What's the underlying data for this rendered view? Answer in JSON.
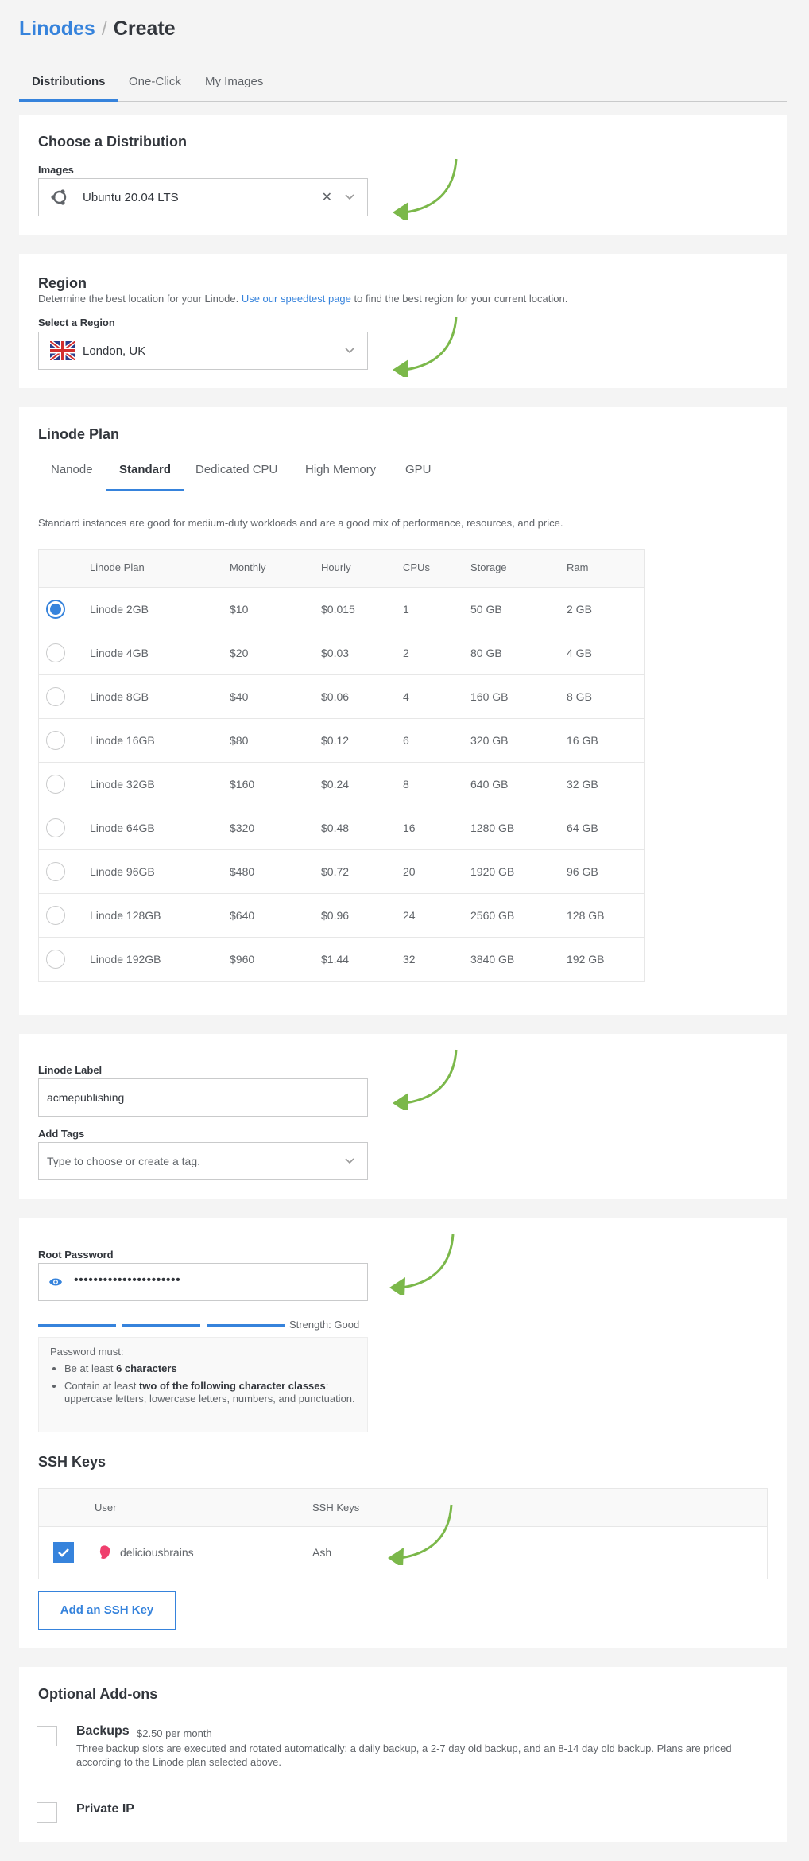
{
  "breadcrumb": {
    "parent": "Linodes",
    "separator": "/",
    "current": "Create"
  },
  "top_tabs": [
    "Distributions",
    "One-Click",
    "My Images"
  ],
  "distribution": {
    "title": "Choose a Distribution",
    "images_label": "Images",
    "selected_image": "Ubuntu 20.04 LTS",
    "clear_glyph": "✕"
  },
  "region": {
    "title": "Region",
    "desc_prefix": "Determine the best location for your Linode.",
    "desc_link": "Use our speedtest page",
    "desc_suffix": "to find the best region for your current location.",
    "select_label": "Select a Region",
    "selected_region": "London, UK"
  },
  "plan": {
    "title": "Linode Plan",
    "tabs": [
      "Nanode",
      "Standard",
      "Dedicated CPU",
      "High Memory",
      "GPU"
    ],
    "description": "Standard instances are good for medium-duty workloads and are a good mix of performance, resources, and price.",
    "headers": [
      "Linode Plan",
      "Monthly",
      "Hourly",
      "CPUs",
      "Storage",
      "Ram"
    ],
    "rows": [
      {
        "name": "Linode 2GB",
        "monthly": "$10",
        "hourly": "$0.015",
        "cpus": "1",
        "storage": "50 GB",
        "ram": "2 GB",
        "selected": true
      },
      {
        "name": "Linode 4GB",
        "monthly": "$20",
        "hourly": "$0.03",
        "cpus": "2",
        "storage": "80 GB",
        "ram": "4 GB",
        "selected": false
      },
      {
        "name": "Linode 8GB",
        "monthly": "$40",
        "hourly": "$0.06",
        "cpus": "4",
        "storage": "160 GB",
        "ram": "8 GB",
        "selected": false
      },
      {
        "name": "Linode 16GB",
        "monthly": "$80",
        "hourly": "$0.12",
        "cpus": "6",
        "storage": "320 GB",
        "ram": "16 GB",
        "selected": false
      },
      {
        "name": "Linode 32GB",
        "monthly": "$160",
        "hourly": "$0.24",
        "cpus": "8",
        "storage": "640 GB",
        "ram": "32 GB",
        "selected": false
      },
      {
        "name": "Linode 64GB",
        "monthly": "$320",
        "hourly": "$0.48",
        "cpus": "16",
        "storage": "1280 GB",
        "ram": "64 GB",
        "selected": false
      },
      {
        "name": "Linode 96GB",
        "monthly": "$480",
        "hourly": "$0.72",
        "cpus": "20",
        "storage": "1920 GB",
        "ram": "96 GB",
        "selected": false
      },
      {
        "name": "Linode 128GB",
        "monthly": "$640",
        "hourly": "$0.96",
        "cpus": "24",
        "storage": "2560 GB",
        "ram": "128 GB",
        "selected": false
      },
      {
        "name": "Linode 192GB",
        "monthly": "$960",
        "hourly": "$1.44",
        "cpus": "32",
        "storage": "3840 GB",
        "ram": "192 GB",
        "selected": false
      }
    ]
  },
  "label_tags": {
    "label_title": "Linode Label",
    "label_value": "acmepublishing",
    "tags_title": "Add Tags",
    "tags_placeholder": "Type to choose or create a tag."
  },
  "password": {
    "title": "Root Password",
    "masked_value": "••••••••••••••••••••••",
    "strength_text": "Strength: Good",
    "strength_level": 3,
    "strength_max": 3,
    "rules_title": "Password must:",
    "rule1_prefix": "Be at least",
    "rule1_bold": "6 characters",
    "rule2_prefix": "Contain at least",
    "rule2_bold": "two of the following character classes",
    "rule2_suffix": ": uppercase letters, lowercase letters, numbers, and punctuation."
  },
  "ssh": {
    "title": "SSH Keys",
    "headers": [
      "User",
      "SSH Keys"
    ],
    "user": "deliciousbrains",
    "key": "Ash",
    "checked": true,
    "add_button": "Add an SSH Key"
  },
  "addons": {
    "title": "Optional Add-ons",
    "backups_name": "Backups",
    "backups_price": "$2.50 per month",
    "backups_desc": "Three backup slots are executed and rotated automatically: a daily backup, a 2-7 day old backup, and an 8-14 day old backup. Plans are priced according to the Linode plan selected above.",
    "private_ip_name": "Private IP"
  },
  "colors": {
    "accent": "#3683dc",
    "arrow": "#7bb84a",
    "avatar": "#ef3f6d"
  },
  "icons": [
    "ubuntu-icon",
    "uk-flag-icon",
    "chevron-down-icon",
    "close-icon",
    "eye-icon",
    "check-icon",
    "user-avatar-icon"
  ]
}
